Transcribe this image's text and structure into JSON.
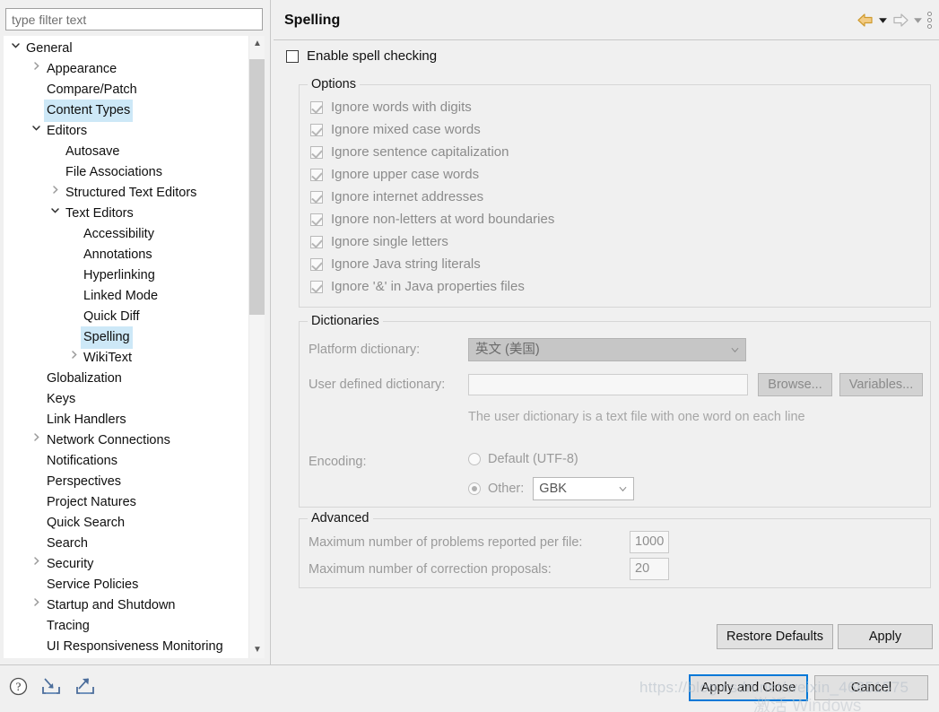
{
  "filter": {
    "placeholder": "type filter text",
    "value": ""
  },
  "tree": {
    "items": [
      {
        "label": "General",
        "depth": 0,
        "twisty": "open",
        "selected": false
      },
      {
        "label": "Appearance",
        "depth": 1,
        "twisty": "collapsed",
        "selected": false
      },
      {
        "label": "Compare/Patch",
        "depth": 1,
        "twisty": "none",
        "selected": false
      },
      {
        "label": "Content Types",
        "depth": 1,
        "twisty": "none",
        "selected": true
      },
      {
        "label": "Editors",
        "depth": 1,
        "twisty": "open",
        "selected": false
      },
      {
        "label": "Autosave",
        "depth": 2,
        "twisty": "none",
        "selected": false
      },
      {
        "label": "File Associations",
        "depth": 2,
        "twisty": "none",
        "selected": false
      },
      {
        "label": "Structured Text Editors",
        "depth": 2,
        "twisty": "collapsed",
        "selected": false
      },
      {
        "label": "Text Editors",
        "depth": 2,
        "twisty": "open",
        "selected": false
      },
      {
        "label": "Accessibility",
        "depth": 3,
        "twisty": "none",
        "selected": false
      },
      {
        "label": "Annotations",
        "depth": 3,
        "twisty": "none",
        "selected": false
      },
      {
        "label": "Hyperlinking",
        "depth": 3,
        "twisty": "none",
        "selected": false
      },
      {
        "label": "Linked Mode",
        "depth": 3,
        "twisty": "none",
        "selected": false
      },
      {
        "label": "Quick Diff",
        "depth": 3,
        "twisty": "none",
        "selected": false
      },
      {
        "label": "Spelling",
        "depth": 3,
        "twisty": "none",
        "selected": true
      },
      {
        "label": "WikiText",
        "depth": 3,
        "twisty": "collapsed",
        "selected": false
      },
      {
        "label": "Globalization",
        "depth": 1,
        "twisty": "none",
        "selected": false
      },
      {
        "label": "Keys",
        "depth": 1,
        "twisty": "none",
        "selected": false
      },
      {
        "label": "Link Handlers",
        "depth": 1,
        "twisty": "none",
        "selected": false
      },
      {
        "label": "Network Connections",
        "depth": 1,
        "twisty": "collapsed",
        "selected": false
      },
      {
        "label": "Notifications",
        "depth": 1,
        "twisty": "none",
        "selected": false
      },
      {
        "label": "Perspectives",
        "depth": 1,
        "twisty": "none",
        "selected": false
      },
      {
        "label": "Project Natures",
        "depth": 1,
        "twisty": "none",
        "selected": false
      },
      {
        "label": "Quick Search",
        "depth": 1,
        "twisty": "none",
        "selected": false
      },
      {
        "label": "Search",
        "depth": 1,
        "twisty": "none",
        "selected": false
      },
      {
        "label": "Security",
        "depth": 1,
        "twisty": "collapsed",
        "selected": false
      },
      {
        "label": "Service Policies",
        "depth": 1,
        "twisty": "none",
        "selected": false
      },
      {
        "label": "Startup and Shutdown",
        "depth": 1,
        "twisty": "collapsed",
        "selected": false
      },
      {
        "label": "Tracing",
        "depth": 1,
        "twisty": "none",
        "selected": false
      },
      {
        "label": "UI Responsiveness Monitoring",
        "depth": 1,
        "twisty": "none",
        "selected": false
      }
    ]
  },
  "header": {
    "title": "Spelling",
    "back_icon": "back-arrow-icon",
    "back_menu_icon": "chevron-down-icon",
    "forward_icon": "forward-arrow-icon",
    "forward_menu_icon": "chevron-down-icon",
    "overflow_icon": "view-menu-icon"
  },
  "main": {
    "enable_spell_checking": {
      "label": "Enable spell checking",
      "checked": false
    },
    "options": {
      "legend": "Options",
      "items": [
        {
          "label": "Ignore words with digits",
          "checked": true
        },
        {
          "label": "Ignore mixed case words",
          "checked": true
        },
        {
          "label": "Ignore sentence capitalization",
          "checked": true
        },
        {
          "label": "Ignore upper case words",
          "checked": true
        },
        {
          "label": "Ignore internet addresses",
          "checked": true
        },
        {
          "label": "Ignore non-letters at word boundaries",
          "checked": true
        },
        {
          "label": "Ignore single letters",
          "checked": true
        },
        {
          "label": "Ignore Java string literals",
          "checked": true
        },
        {
          "label": "Ignore '&' in Java properties files",
          "checked": true
        }
      ]
    },
    "dictionaries": {
      "legend": "Dictionaries",
      "platform_dictionary_label": "Platform dictionary:",
      "platform_dictionary_value": "英文 (美国)",
      "user_dictionary_label": "User defined dictionary:",
      "user_dictionary_value": "",
      "browse_button": "Browse...",
      "variables_button": "Variables...",
      "hint": "The user dictionary is a text file with one word on each line",
      "encoding_label": "Encoding:",
      "encoding_default_label": "Default (UTF-8)",
      "encoding_default_selected": false,
      "encoding_other_label": "Other:",
      "encoding_other_selected": true,
      "encoding_other_value": "GBK"
    },
    "advanced": {
      "legend": "Advanced",
      "max_problems_label": "Maximum number of problems reported per file:",
      "max_problems_value": "1000",
      "max_proposals_label": "Maximum number of correction proposals:",
      "max_proposals_value": "20"
    },
    "restore_defaults_button": "Restore Defaults",
    "apply_button": "Apply"
  },
  "footer": {
    "help_icon": "help-icon",
    "import_icon": "import-icon",
    "export_icon": "export-icon",
    "apply_and_close_button": "Apply and Close",
    "cancel_button": "Cancel"
  },
  "watermark": {
    "url": "https://blog.csdn.net/weixin_46851575",
    "activate": "激活 Windows"
  },
  "colors": {
    "selection": "#cde8f7",
    "focus_border": "#0078d7",
    "background": "#f0f0f0",
    "back_arrow": "#e8a33d"
  }
}
